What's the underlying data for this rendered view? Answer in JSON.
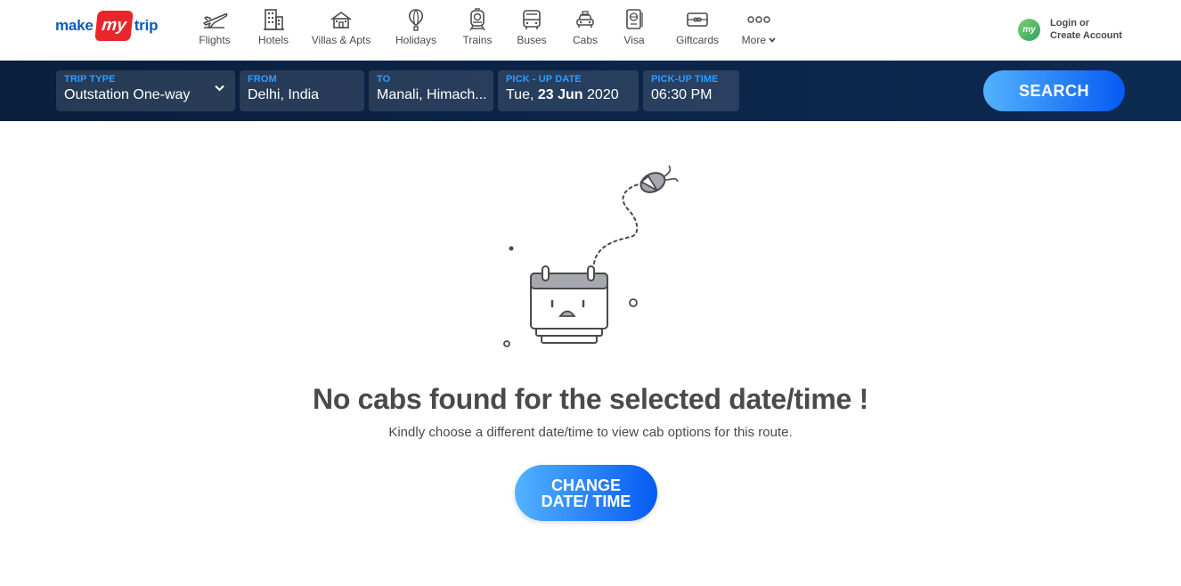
{
  "header": {
    "logo": {
      "make": "make",
      "my": "my",
      "trip": "trip"
    },
    "nav": [
      {
        "label": "Flights",
        "icon": "flight-icon"
      },
      {
        "label": "Hotels",
        "icon": "hotel-icon"
      },
      {
        "label": "Villas & Apts",
        "icon": "villa-icon"
      },
      {
        "label": "Holidays",
        "icon": "holiday-balloon-icon"
      },
      {
        "label": "Trains",
        "icon": "train-icon"
      },
      {
        "label": "Buses",
        "icon": "bus-icon"
      },
      {
        "label": "Cabs",
        "icon": "cab-icon"
      },
      {
        "label": "Visa",
        "icon": "passport-icon"
      },
      {
        "label": "Giftcards",
        "icon": "giftcard-icon"
      },
      {
        "label": "More",
        "icon": "more-dots-icon"
      }
    ],
    "login": {
      "avatar_text": "my",
      "line1": "Login or",
      "line2": "Create Account"
    }
  },
  "search": {
    "trip_type": {
      "label": "TRIP TYPE",
      "value": "Outstation One-way"
    },
    "from": {
      "label": "FROM",
      "value": "Delhi, India"
    },
    "to": {
      "label": "TO",
      "value": "Manali, Himach..."
    },
    "pickup_date": {
      "label": "PICK - UP DATE",
      "day": "Tue,",
      "date": "23 Jun",
      "year": "2020"
    },
    "pickup_time": {
      "label": "PICK-UP TIME",
      "value": "06:30 PM"
    },
    "button": "SEARCH"
  },
  "empty_state": {
    "title": "No cabs found for the selected date/time !",
    "subtitle": "Kindly choose a different date/time to view cab options for this route.",
    "button_line1": "CHANGE",
    "button_line2": "DATE/ TIME"
  },
  "colors": {
    "brand_blue": "#0b5bbd",
    "brand_red": "#e8262c",
    "search_bar_bg": "#0a1f3d",
    "field_label": "#2f9bff",
    "button_gradient_start": "#53b2fe",
    "button_gradient_end": "#065af3",
    "text": "#4a4a4a"
  }
}
